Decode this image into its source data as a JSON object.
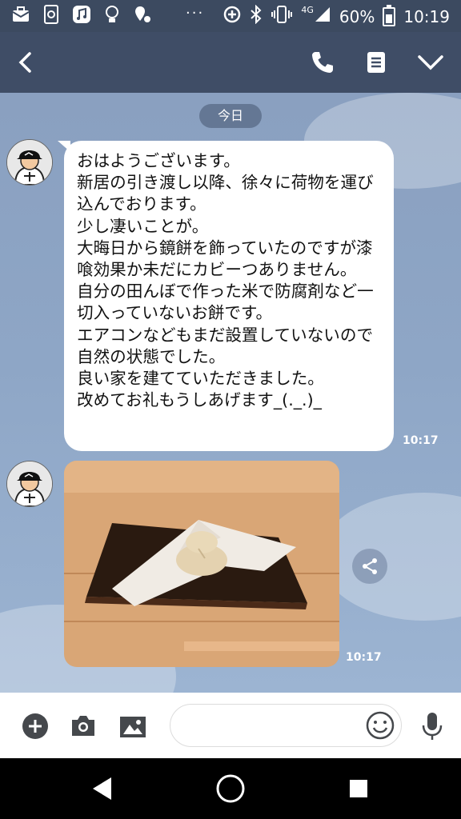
{
  "status_bar": {
    "network_label": "4G",
    "battery_percent": "60%",
    "time": "10:19",
    "icons": [
      "mail-briefcase-icon",
      "sync-icon",
      "music-icon",
      "bulb-icon",
      "location-icon",
      "more-dots-icon",
      "data-saver-icon",
      "bluetooth-icon",
      "vibrate-icon",
      "signal-icon",
      "battery-icon"
    ]
  },
  "header": {
    "icons": [
      "back-chevron-icon",
      "phone-icon",
      "menu-list-icon",
      "chevron-down-icon"
    ]
  },
  "chat": {
    "date_badge": "今日",
    "messages": [
      {
        "type": "text",
        "text": "おはようございます。\n新居の引き渡し以降、徐々に荷物を運び込んでおります。\n少し凄いことが。\n大晦日から鏡餅を飾っていたのですが漆喰効果か未だにカビーつありません。\n自分の田んぼで作った米で防腐剤など一切入っていないお餅です。\nエアコンなどもまだ設置していないので自然の状態でした。\n良い家を建てていただきました。\n改めてお礼もうしあげます_(._.)_",
        "time": "10:17"
      },
      {
        "type": "image",
        "image_desc_icon": "photo-kagami-mochi",
        "time": "10:17"
      }
    ],
    "share_icon": "share-icon"
  },
  "input_bar": {
    "placeholder": "",
    "icons": [
      "plus-icon",
      "camera-icon",
      "gallery-icon",
      "emoji-icon",
      "mic-icon"
    ]
  },
  "nav_bar": {
    "icons": [
      "back-triangle-icon",
      "home-circle-icon",
      "recents-square-icon"
    ]
  }
}
